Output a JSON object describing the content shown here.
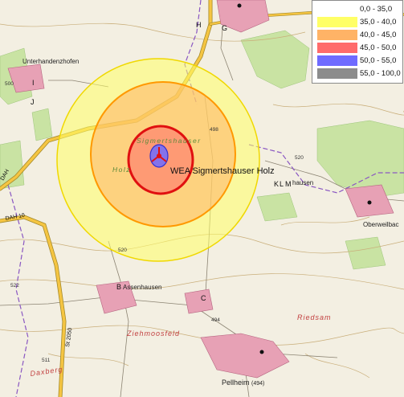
{
  "legend": {
    "items": [
      {
        "range": "0,0 - 35,0",
        "color": "#ffffff"
      },
      {
        "range": "35,0 - 40,0",
        "color": "#ffff66"
      },
      {
        "range": "40,0 - 45,0",
        "color": "#ffb366"
      },
      {
        "range": "45,0 - 50,0",
        "color": "#ff6b6b"
      },
      {
        "range": "50,0 - 55,0",
        "color": "#6f6bff"
      },
      {
        "range": "55,0 - 100,0",
        "color": "#8c8c8c"
      }
    ]
  },
  "turbine": {
    "label": "WEA Sigmertshauser Holz"
  },
  "places": {
    "unterhandenzhofen": "Unterhandenzhofen",
    "assenhausen": "Assenhausen",
    "ziehmoosfeld": "Ziehmoosfeld",
    "riedsam": "Riedsam",
    "pellheim": "Pellheim",
    "pellheim_elev": "(494)",
    "oberweilbach": "Oberweilbac",
    "daxberg": "Daxberg",
    "sigmertshauser": "Sigmertshauser",
    "holz_label": "Holz",
    "hausen": "hausen"
  },
  "markers": {
    "h": "H",
    "g": "G",
    "i": "I",
    "j": "J",
    "b": "B",
    "c": "C",
    "k": "K",
    "l": "L",
    "m": "M"
  },
  "elevations": {
    "e500": "500",
    "e498": "498",
    "e520a": "520",
    "e520b": "520",
    "e522": "522",
    "e494": "494",
    "e511": "511"
  },
  "roads": {
    "dah10": "DAH 10",
    "st2050": "St 2050",
    "dah_partial": "DAH"
  },
  "colors": {
    "map_bg": "#f3efe2",
    "forest": "#c9e3a3",
    "road_main": "#f5c542",
    "settlement": "#e7a1b5"
  }
}
